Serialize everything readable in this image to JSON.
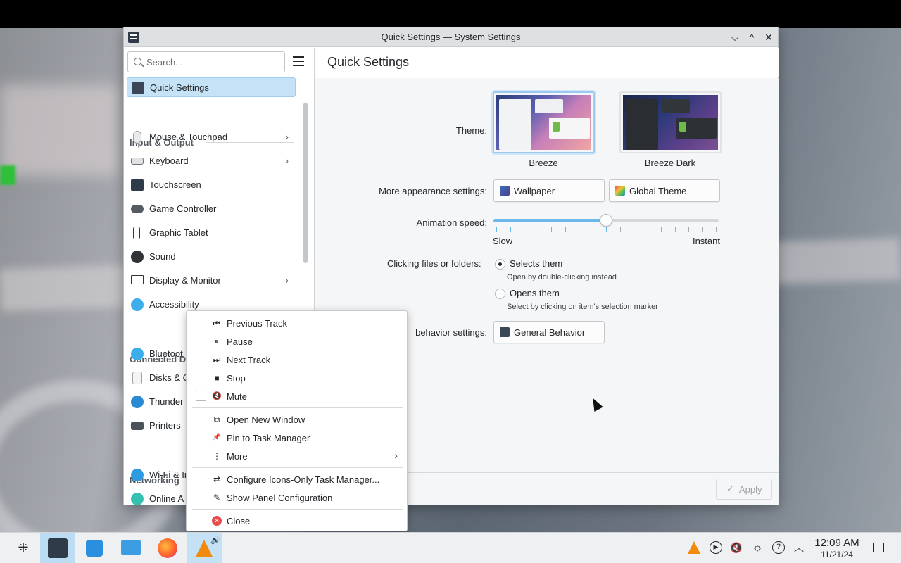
{
  "window": {
    "title": "Quick Settings — System Settings",
    "controls": {
      "minimize": "⌵",
      "maximize": "^",
      "close": "✕"
    }
  },
  "sidebar": {
    "search_placeholder": "Search...",
    "items": [
      {
        "label": "Quick Settings",
        "icon": "quick-settings-icon",
        "selected": true
      },
      {
        "label": "Mouse & Touchpad",
        "icon": "mouse-icon",
        "has_submenu": true
      },
      {
        "label": "Keyboard",
        "icon": "keyboard-icon",
        "has_submenu": true
      },
      {
        "label": "Touchscreen",
        "icon": "touchscreen-icon"
      },
      {
        "label": "Game Controller",
        "icon": "gamepad-icon"
      },
      {
        "label": "Graphic Tablet",
        "icon": "tablet-icon"
      },
      {
        "label": "Sound",
        "icon": "sound-icon"
      },
      {
        "label": "Display & Monitor",
        "icon": "monitor-icon",
        "has_submenu": true
      },
      {
        "label": "Accessibility",
        "icon": "accessibility-icon"
      },
      {
        "label": "Bluetoot",
        "icon": "bluetooth-icon"
      },
      {
        "label": "Disks & C",
        "icon": "disk-icon"
      },
      {
        "label": "Thunder",
        "icon": "thunderbolt-icon"
      },
      {
        "label": "Printers",
        "icon": "printer-icon"
      },
      {
        "label": "Wi-Fi & In",
        "icon": "wifi-icon"
      },
      {
        "label": "Online A",
        "icon": "online-accounts-icon"
      }
    ],
    "headers": {
      "input_output": "Input & Output",
      "connected": "Connected D",
      "networking": "Networking"
    },
    "chevron": "›"
  },
  "content": {
    "page_title": "Quick Settings",
    "theme_label": "Theme:",
    "themes": [
      {
        "name": "Breeze",
        "selected": true
      },
      {
        "name": "Breeze Dark",
        "selected": false
      }
    ],
    "more_appearance_label": "More appearance settings:",
    "wallpaper_button": "Wallpaper",
    "global_theme_button": "Global Theme",
    "animation_label": "Animation speed:",
    "animation_slow": "Slow",
    "animation_instant": "Instant",
    "animation_value_fraction": 0.5,
    "clicking_label": "Clicking files or folders:",
    "radio_selects": "Selects them",
    "radio_selects_sub": "Open by double-clicking instead",
    "radio_opens": "Opens them",
    "radio_opens_sub": "Select by clicking on item's selection marker",
    "behavior_label": "behavior settings:",
    "general_behavior_button": "General Behavior",
    "apply_button": "Apply",
    "apply_check": "✓"
  },
  "context_menu": {
    "items": [
      {
        "label": "Previous Track",
        "icon": "previous-track-icon",
        "glyph": "⏮"
      },
      {
        "label": "Pause",
        "icon": "pause-icon",
        "glyph": "⏸"
      },
      {
        "label": "Next Track",
        "icon": "next-track-icon",
        "glyph": "⏭"
      },
      {
        "label": "Stop",
        "icon": "stop-icon",
        "glyph": "■"
      },
      {
        "label": "Mute",
        "icon": "mute-icon",
        "glyph": "🔇",
        "checkbox": true
      },
      {
        "label": "Open New Window",
        "icon": "new-window-icon",
        "glyph": "⧉"
      },
      {
        "label": "Pin to Task Manager",
        "icon": "pin-icon",
        "glyph": "📌"
      },
      {
        "label": "More",
        "icon": "more-icon",
        "glyph": "⋮",
        "has_submenu": true
      },
      {
        "label": "Configure Icons-Only Task Manager...",
        "icon": "configure-icon",
        "glyph": "⇄"
      },
      {
        "label": "Show Panel Configuration",
        "icon": "edit-icon",
        "glyph": "✎"
      },
      {
        "label": "Close",
        "icon": "close-icon",
        "glyph": "✕"
      }
    ],
    "submenu_chevron": "›"
  },
  "taskbar": {
    "clock_time": "12:09 AM",
    "clock_date": "11/21/24"
  },
  "colors": {
    "accent": "#3daee9",
    "selection_bg": "#c6e2f7",
    "close_red": "#e74c4c"
  }
}
